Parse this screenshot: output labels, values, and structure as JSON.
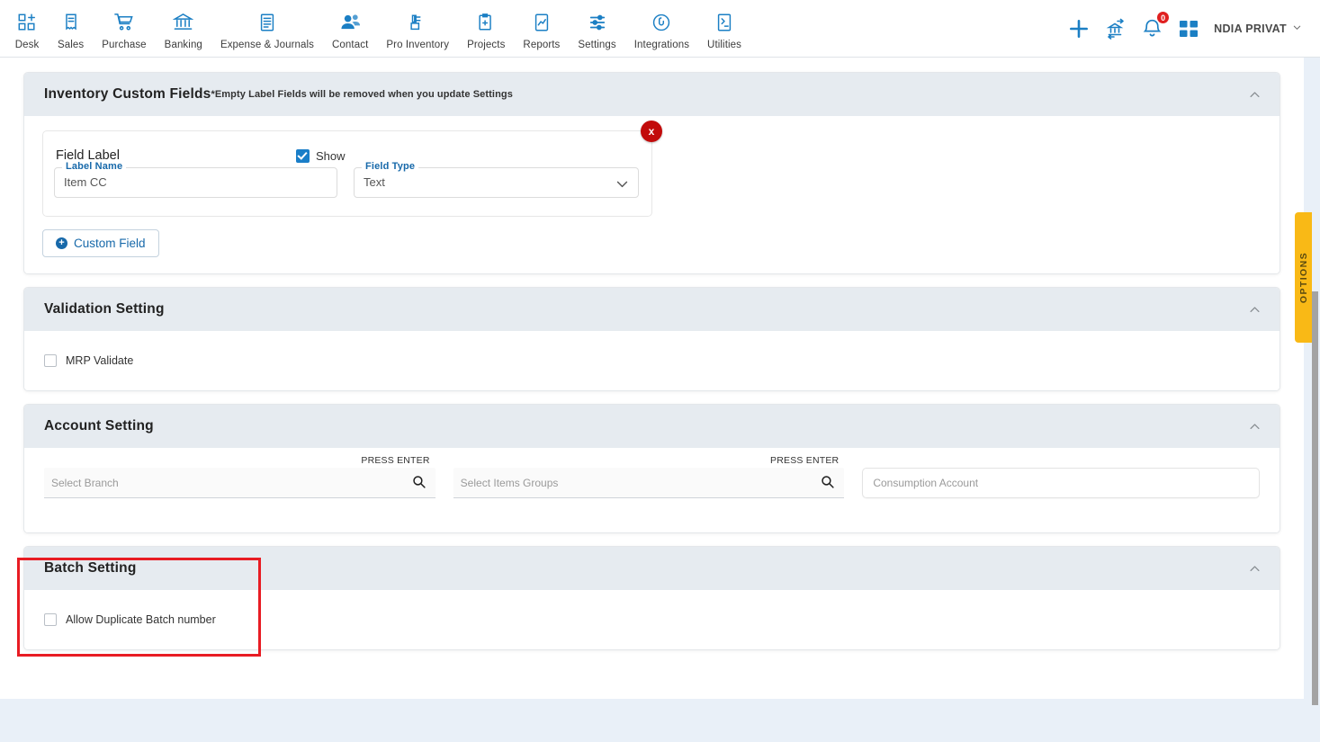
{
  "topnav": {
    "items": [
      {
        "label": "Desk",
        "icon": "desk-grid-plus-icon"
      },
      {
        "label": "Sales",
        "icon": "sales-receipt-icon"
      },
      {
        "label": "Purchase",
        "icon": "purchase-cart-icon"
      },
      {
        "label": "Banking",
        "icon": "banking-bank-icon"
      },
      {
        "label": "Expense & Journals",
        "icon": "expense-journal-icon"
      },
      {
        "label": "Contact",
        "icon": "contact-people-icon"
      },
      {
        "label": "Pro Inventory",
        "icon": "pro-inventory-icon"
      },
      {
        "label": "Projects",
        "icon": "projects-clipboard-icon"
      },
      {
        "label": "Reports",
        "icon": "reports-chart-icon"
      },
      {
        "label": "Settings",
        "icon": "settings-sliders-icon"
      },
      {
        "label": "Integrations",
        "icon": "integrations-plug-icon"
      },
      {
        "label": "Utilities",
        "icon": "utilities-tools-icon"
      }
    ],
    "right": {
      "add_icon": "plus-icon",
      "transfer_icon": "bank-transfer-icon",
      "notification_icon": "bell-icon",
      "notification_count": "0",
      "apps_icon": "apps-grid-icon",
      "company_name": "NDIA PRIVAT",
      "company_caret_icon": "chevron-down-icon"
    }
  },
  "colors": {
    "accent_blue": "#1769aa",
    "highlight_red": "#e81c23",
    "options_yellow": "#f9b916",
    "delete_red": "#c20b0b",
    "page_bg": "#e9f0f8",
    "card_header_bg": "#e6ebf0"
  },
  "sections": {
    "inventory_custom_fields": {
      "title": "Inventory Custom Fields",
      "note": "*Empty Label Fields will be removed when you update Settings",
      "collapse_icon": "chevron-up-icon",
      "field": {
        "remove_label": "x",
        "field_label_text": "Field Label",
        "show_label": "Show",
        "show_checked": true,
        "label_name_label": "Label Name",
        "label_name_value": "Item CC",
        "field_type_label": "Field Type",
        "field_type_value": "Text",
        "field_type_caret_icon": "chevron-down-icon"
      },
      "add_button_label": "Custom Field",
      "add_button_icon": "plus-circle-icon"
    },
    "validation_setting": {
      "title": "Validation Setting",
      "collapse_icon": "chevron-up-icon",
      "mrp_validate_label": "MRP Validate",
      "mrp_validate_checked": false
    },
    "account_setting": {
      "title": "Account Setting",
      "collapse_icon": "chevron-up-icon",
      "branch": {
        "placeholder": "Select Branch",
        "hint": "PRESS ENTER",
        "search_icon": "search-icon"
      },
      "items_groups": {
        "placeholder": "Select Items Groups",
        "hint": "PRESS ENTER",
        "search_icon": "search-icon"
      },
      "consumption_account": {
        "placeholder": "Consumption Account"
      }
    },
    "batch_setting": {
      "title": "Batch Setting",
      "collapse_icon": "chevron-up-icon",
      "allow_duplicate_label": "Allow Duplicate Batch number",
      "allow_duplicate_checked": false,
      "highlighted": true
    }
  },
  "options_tab": {
    "label": "OPTIONS"
  }
}
